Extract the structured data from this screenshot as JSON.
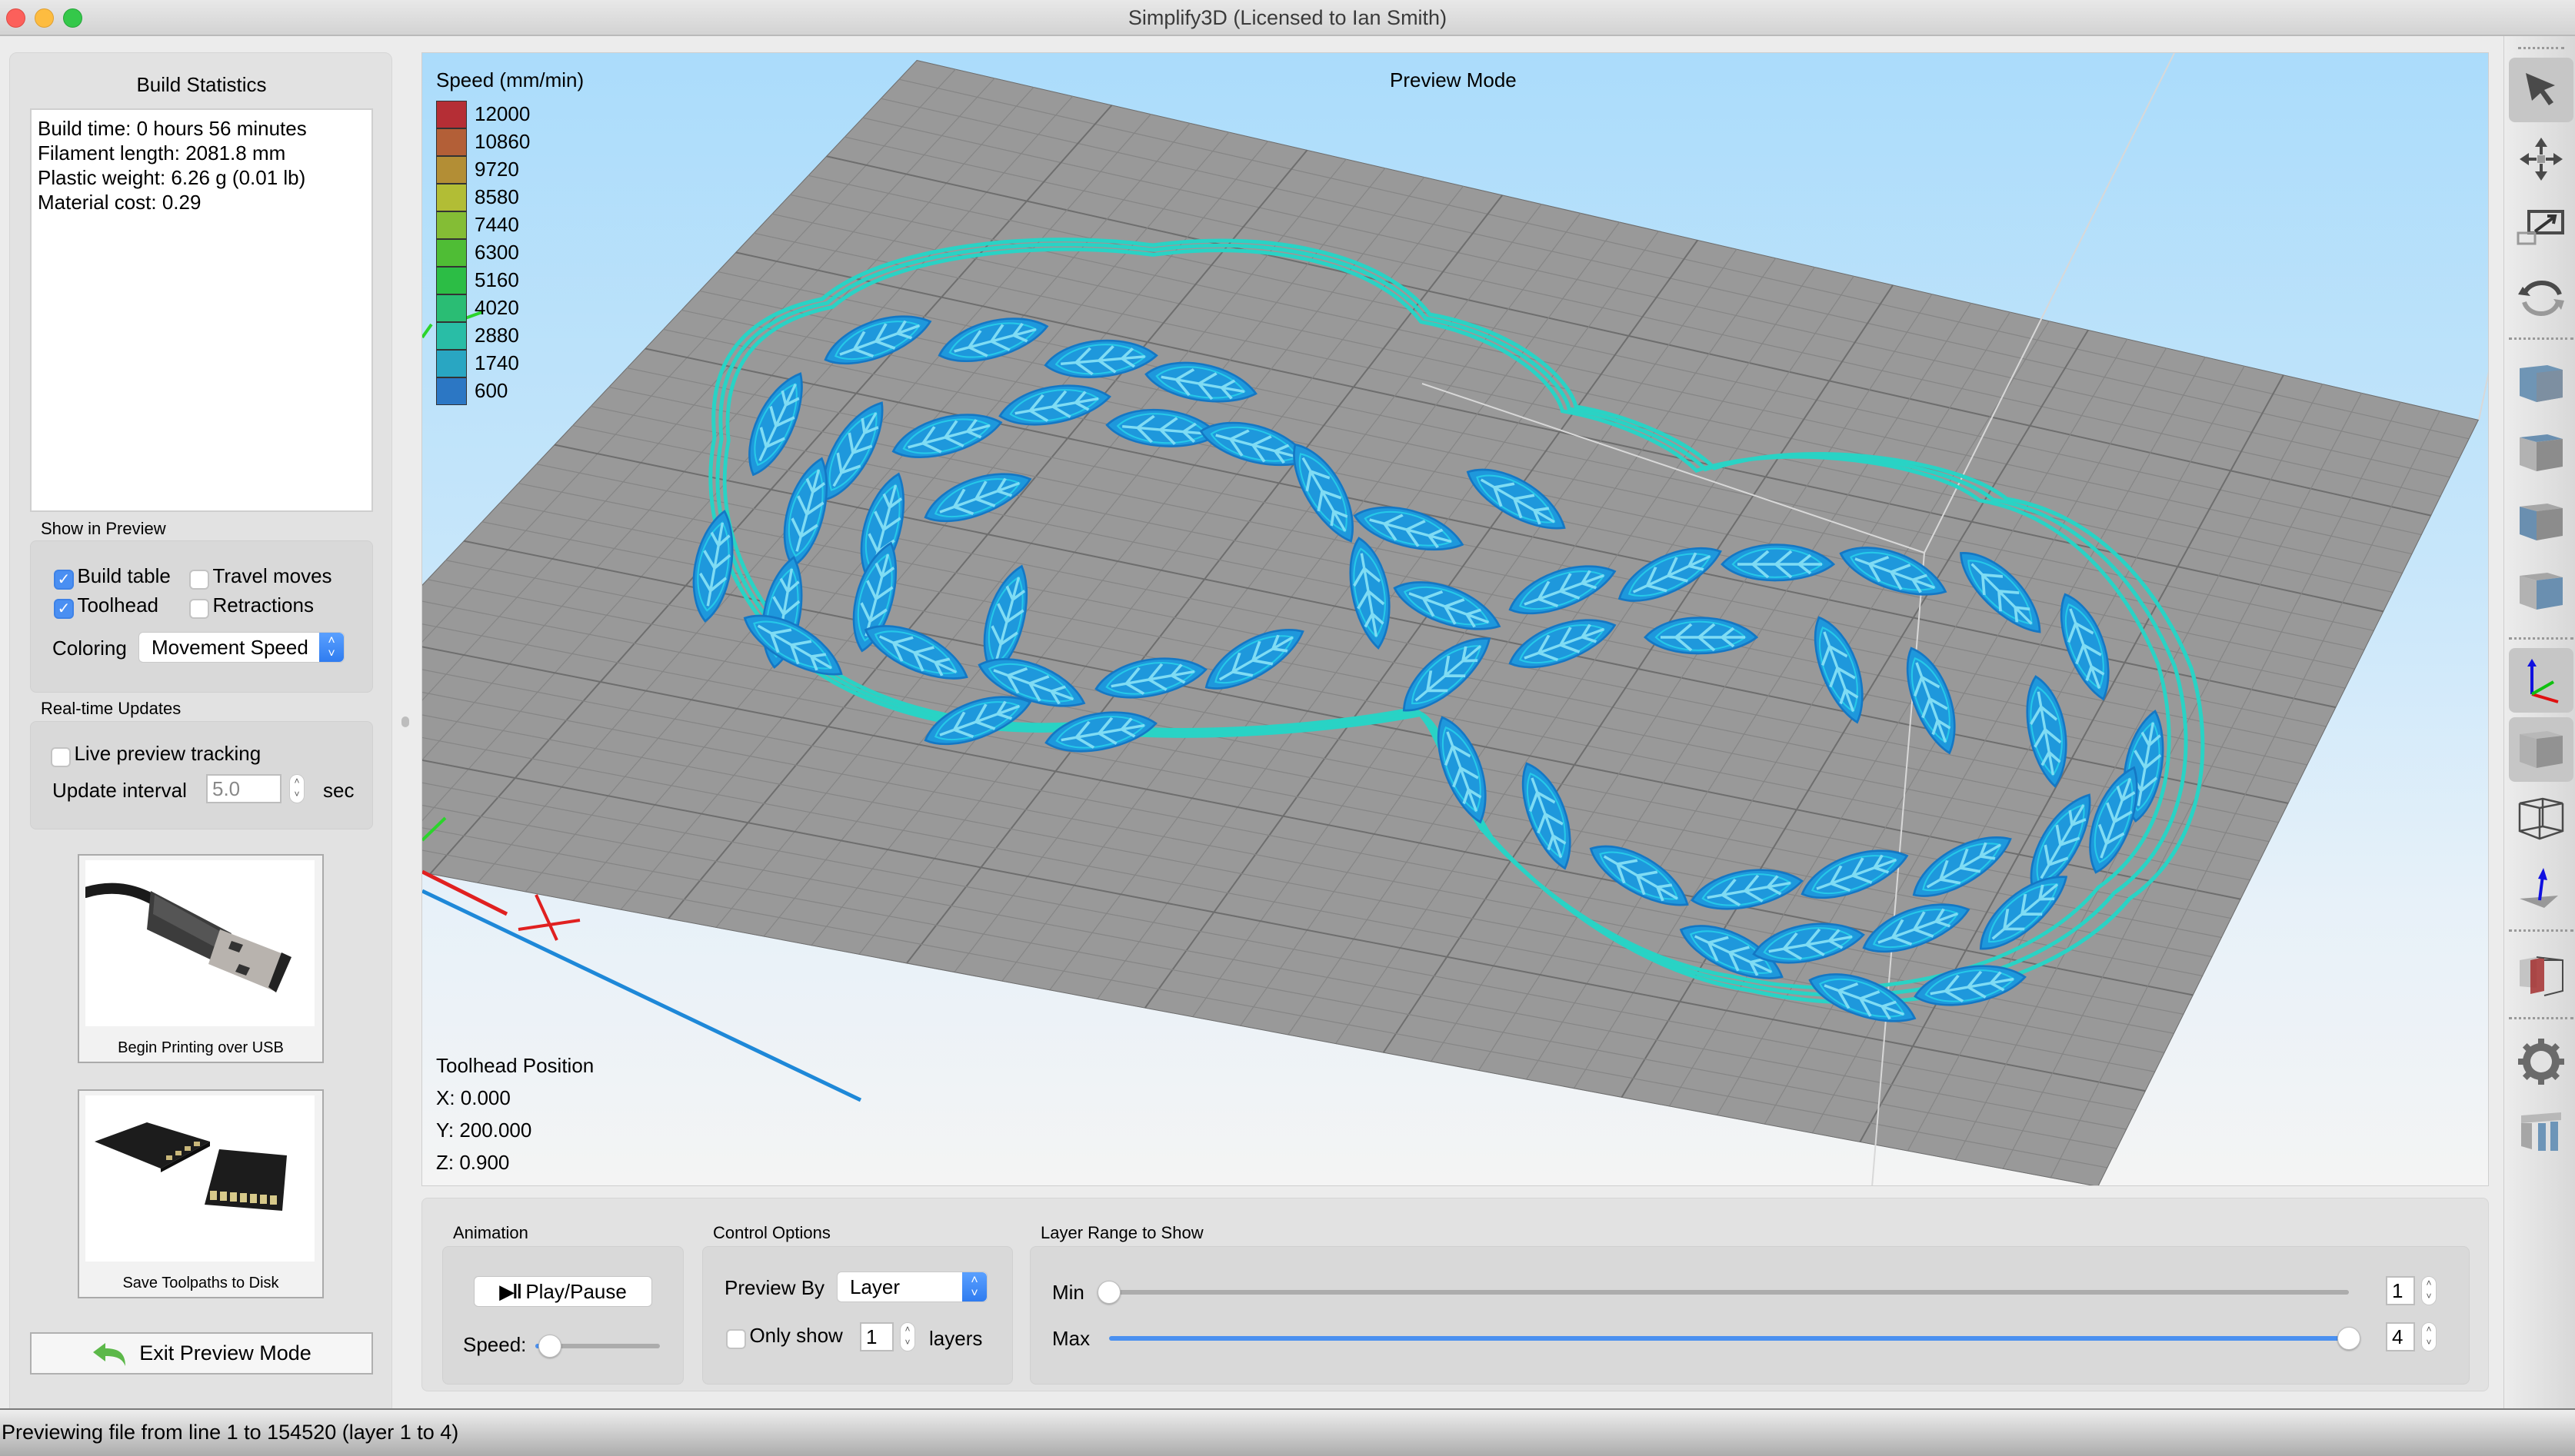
{
  "window": {
    "title": "Simplify3D (Licensed to Ian Smith)",
    "controls": {
      "close_color": "#fc605b",
      "minimize_color": "#fdbc40",
      "maximize_color": "#34c84a"
    }
  },
  "left_panel": {
    "build_statistics": {
      "title": "Build Statistics",
      "lines": [
        "Build time: 0 hours 56 minutes",
        "Filament length: 2081.8 mm",
        "Plastic weight: 6.26 g (0.01 lb)",
        "Material cost: 0.29"
      ]
    },
    "show_in_preview": {
      "label": "Show in Preview",
      "checkboxes": [
        {
          "label": "Build table",
          "checked": true
        },
        {
          "label": "Travel moves",
          "checked": false
        },
        {
          "label": "Toolhead",
          "checked": true
        },
        {
          "label": "Retractions",
          "checked": false
        }
      ],
      "coloring_label": "Coloring",
      "coloring_value": "Movement Speed"
    },
    "realtime_updates": {
      "label": "Real-time Updates",
      "live_tracking_label": "Live preview tracking",
      "live_tracking_checked": false,
      "interval_label": "Update interval",
      "interval_value": "5.0",
      "interval_unit": "sec"
    },
    "usb_button_label": "Begin Printing over USB",
    "disk_button_label": "Save Toolpaths to Disk",
    "exit_button_label": "Exit Preview Mode"
  },
  "viewport": {
    "mode_label": "Preview Mode",
    "legend": {
      "title": "Speed (mm/min)",
      "entries": [
        {
          "value": "12000",
          "color": "#b52e35"
        },
        {
          "value": "10860",
          "color": "#b35f37"
        },
        {
          "value": "9720",
          "color": "#b38e35"
        },
        {
          "value": "8580",
          "color": "#b2bd35"
        },
        {
          "value": "7440",
          "color": "#84bd35"
        },
        {
          "value": "6300",
          "color": "#4fbd35"
        },
        {
          "value": "5160",
          "color": "#2cbd45"
        },
        {
          "value": "4020",
          "color": "#2abd74"
        },
        {
          "value": "2880",
          "color": "#29bda6"
        },
        {
          "value": "1740",
          "color": "#29a6c2"
        },
        {
          "value": "600",
          "color": "#2c77c4"
        }
      ]
    },
    "toolhead": {
      "title": "Toolhead Position",
      "x": "X: 0.000",
      "y": "Y: 200.000",
      "z": "Z: 0.900"
    },
    "colors": {
      "plate": "#999999",
      "perimeter": "#29d3c5",
      "leaf": "#1e98dc",
      "leaf_inner": "#26c8e8"
    }
  },
  "controls": {
    "animation": {
      "label": "Animation",
      "play_pause_label": "Play/Pause",
      "speed_label": "Speed:",
      "speed_fraction": 0.05
    },
    "control_options": {
      "label": "Control Options",
      "preview_by_label": "Preview By",
      "preview_by_value": "Layer",
      "only_show_label": "Only show",
      "only_show_checked": false,
      "only_show_value": "1",
      "layers_label": "layers"
    },
    "layer_range": {
      "label": "Layer Range to Show",
      "min_label": "Min",
      "min_value": "1",
      "max_label": "Max",
      "max_value": "4",
      "total_layers": 4
    }
  },
  "toolbar": {
    "tools": [
      "select-icon",
      "move-icon",
      "scale-icon",
      "rotate-icon",
      "view-iso-icon",
      "view-top-icon",
      "view-front-icon",
      "view-side-icon",
      "axes-icon",
      "solid-view-icon",
      "wireframe-view-icon",
      "normals-icon",
      "cross-section-icon",
      "settings-icon",
      "supports-icon"
    ]
  },
  "status_bar": {
    "text": "Previewing file from line 1 to 154520 (layer 1 to 4)"
  }
}
